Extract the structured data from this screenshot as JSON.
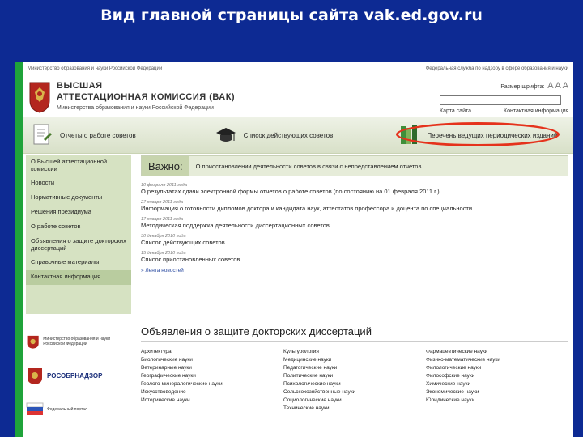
{
  "slide": {
    "title": "Вид главной страницы сайта vak.ed.gov.ru"
  },
  "topbar": {
    "left": "Министерство образования и науки Российской Федерации",
    "right": "Федеральная служба по надзору в сфере образования и науки"
  },
  "header": {
    "brand_line1": "ВЫСШАЯ",
    "brand_line2": "АТТЕСТАЦИОННАЯ КОМИССИЯ (ВАК)",
    "brand_line3": "Министерства образования и науки Российской Федерации",
    "font_size_label": "Размер шрифта:",
    "font_size_glyphs": "A A A",
    "sitemap": "Карта сайта",
    "contacts": "Контактная информация"
  },
  "tabs": [
    {
      "label": "Отчеты о работе советов"
    },
    {
      "label": "Список действующих советов"
    },
    {
      "label": "Перечень ведущих периодических изданий"
    }
  ],
  "sidebar": {
    "items": [
      "О Высшей аттестационной комиссии",
      "Новости",
      "Нормативные документы",
      "Решения президиума",
      "О работе советов",
      "Объявления о защите докторских диссертаций",
      "Справочные материалы",
      "Контактная информация"
    ]
  },
  "important": {
    "label": "Важно:",
    "text": "О приостановлении деятельности советов в связи с непредставлением отчетов"
  },
  "news": [
    {
      "date": "10 февраля 2011 года",
      "title": "О результатах сдачи электронной формы отчетов о работе советов (по состоянию на 01 февраля 2011 г.)"
    },
    {
      "date": "27 января 2011 года",
      "title": "Информация о готовности дипломов доктора и кандидата наук, аттестатов профессора и доцента по специальности"
    },
    {
      "date": "17 января 2011 года",
      "title": "Методическая поддержка деятельности диссертационных советов"
    },
    {
      "date": "30 декабря 2010 года",
      "title": "Список действующих советов"
    },
    {
      "date": "15 декабря 2010 года",
      "title": "Список приостановленных советов"
    }
  ],
  "news_link": "» Лента новостей",
  "logos": [
    {
      "caption": "Министерство образования и науки Российской Федерации"
    },
    {
      "caption": "РОСОБРНАДЗОР"
    },
    {
      "caption": "Федеральный портал"
    }
  ],
  "dissertations": {
    "title": "Объявления о защите докторских диссертаций",
    "col1": [
      "Архитектура",
      "Биологические науки",
      "Ветеринарные науки",
      "Географические науки",
      "Геолого-минералогические науки",
      "Искусствоведение",
      "Исторические науки"
    ],
    "col2": [
      "Культурология",
      "Медицинские науки",
      "Педагогические науки",
      "Политические науки",
      "Психологические науки",
      "Сельскохозяйственные науки",
      "Социологические науки",
      "Технические науки"
    ],
    "col3": [
      "Фармацевтические науки",
      "Физико-математические науки",
      "Филологические науки",
      "Философские науки",
      "Химические науки",
      "Экономические науки",
      "Юридические науки"
    ]
  },
  "colors": {
    "background": "#0d2a93",
    "accent_green": "#1fa33a",
    "highlight_oval": "#e5321c"
  }
}
